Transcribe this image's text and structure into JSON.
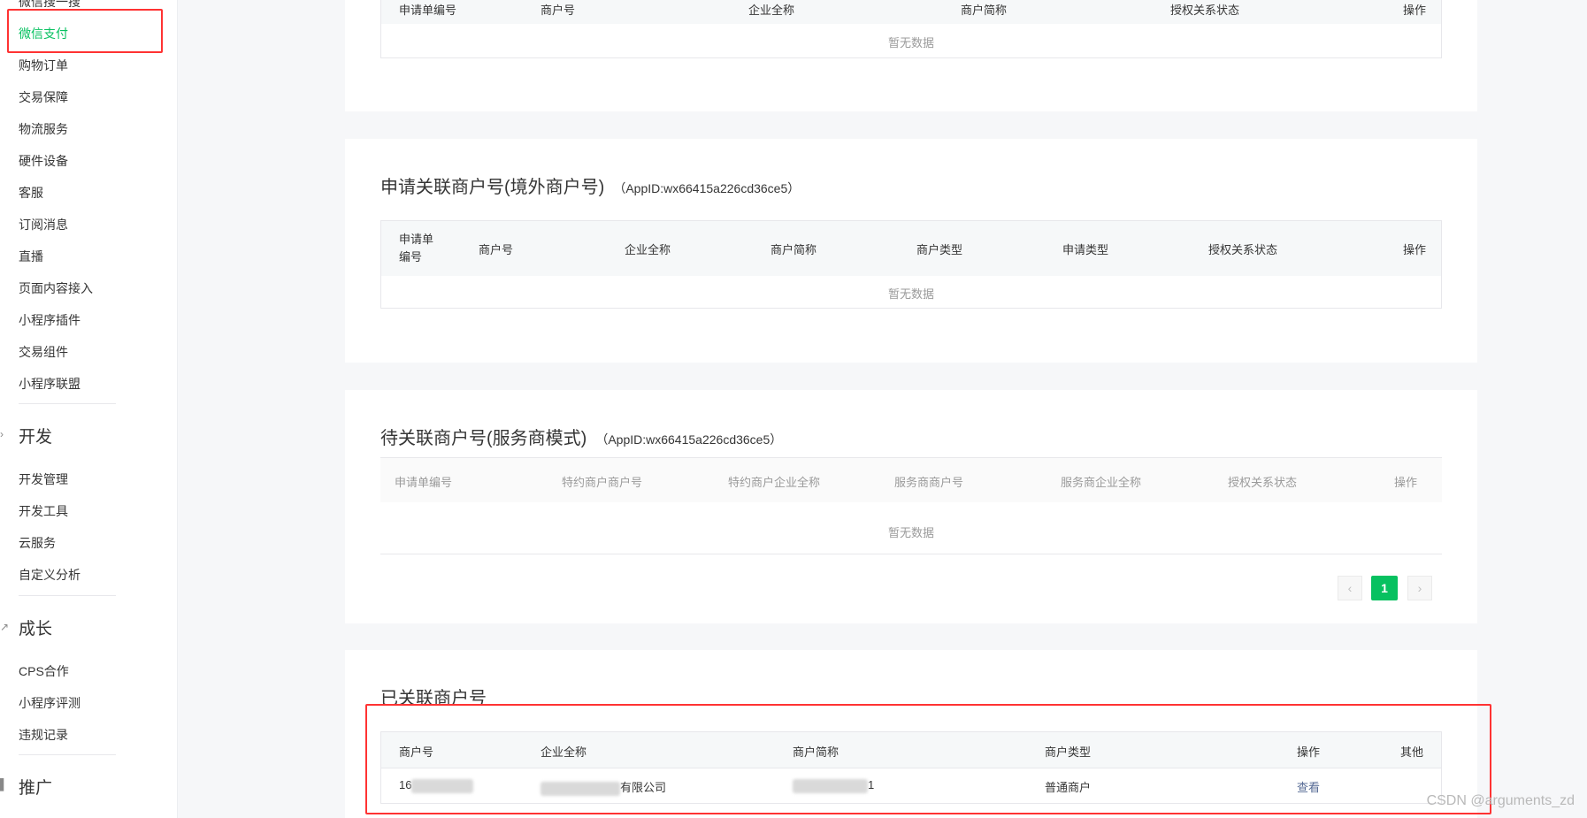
{
  "sidebar": {
    "items_top": [
      "微信搜一搜",
      "微信支付",
      "购物订单",
      "交易保障",
      "物流服务",
      "硬件设备",
      "客服",
      "订阅消息",
      "直播",
      "页面内容接入",
      "小程序插件",
      "交易组件",
      "小程序联盟"
    ],
    "active_index": 1,
    "group_dev": "开发",
    "items_dev": [
      "开发管理",
      "开发工具",
      "云服务",
      "自定义分析"
    ],
    "group_growth": "成长",
    "items_growth": [
      "CPS合作",
      "小程序评测",
      "违规记录"
    ],
    "group_promo": "推广"
  },
  "card1": {
    "headers": [
      "申请单编号",
      "商户号",
      "企业全称",
      "商户简称",
      "授权关系状态",
      "操作"
    ],
    "empty_text": "暂无数据"
  },
  "card2": {
    "title": "申请关联商户号(境外商户号)",
    "appid": "（AppID:wx66415a226cd36ce5）",
    "headers": [
      "申请单编号",
      "商户号",
      "企业全称",
      "商户简称",
      "商户类型",
      "申请类型",
      "授权关系状态",
      "操作"
    ],
    "empty_text": "暂无数据"
  },
  "card3": {
    "title": "待关联商户号(服务商模式)",
    "appid": "（AppID:wx66415a226cd36ce5）",
    "headers": [
      "申请单编号",
      "特约商户商户号",
      "特约商户企业全称",
      "服务商商户号",
      "服务商企业全称",
      "授权关系状态",
      "操作"
    ],
    "empty_text": "暂无数据",
    "pager": {
      "prev": "‹",
      "page": "1",
      "next": "›"
    }
  },
  "card4": {
    "title": "已关联商户号",
    "headers": [
      "商户号",
      "企业全称",
      "商户简称",
      "商户类型",
      "操作",
      "其他"
    ],
    "row": {
      "merchant_id_prefix": "16",
      "company_suffix": "有限公司",
      "short_suffix": "1",
      "type": "普通商户",
      "action": "查看"
    }
  },
  "watermark": "CSDN @arguments_zd",
  "colors": {
    "accent": "#07c160",
    "highlight": "#ff3333",
    "link": "#576b95"
  }
}
